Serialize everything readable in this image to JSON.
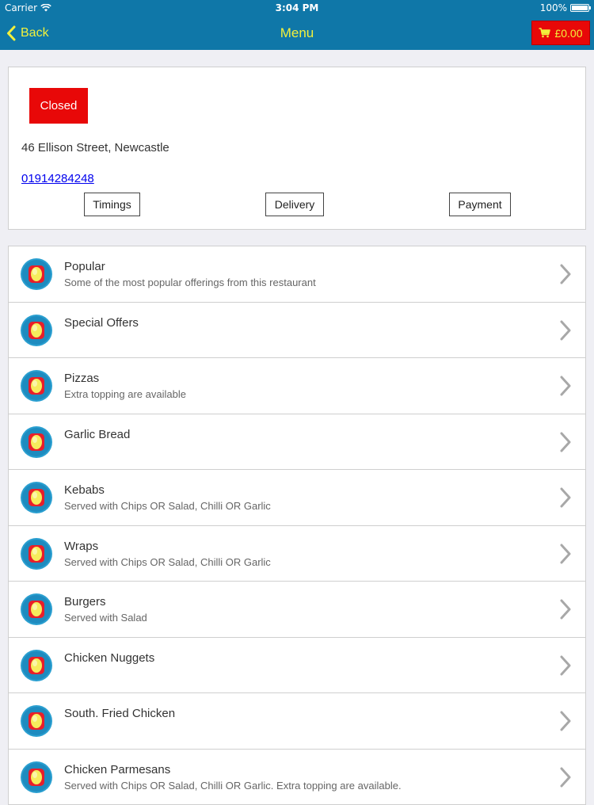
{
  "status_bar": {
    "carrier": "Carrier",
    "time": "3:04 PM",
    "battery": "100%"
  },
  "nav": {
    "back_label": "Back",
    "title": "Menu",
    "cart_total": "£0.00"
  },
  "info": {
    "status": "Closed",
    "address": "46 Ellison Street, Newcastle",
    "phone": "01914284248",
    "buttons": {
      "timings": "Timings",
      "delivery": "Delivery",
      "payment": "Payment"
    }
  },
  "menu": {
    "items": [
      {
        "title": "Popular",
        "subtitle": "Some of the most popular offerings from this restaurant"
      },
      {
        "title": "Special Offers",
        "subtitle": ""
      },
      {
        "title": "Pizzas",
        "subtitle": "Extra topping are available"
      },
      {
        "title": "Garlic Bread",
        "subtitle": ""
      },
      {
        "title": "Kebabs",
        "subtitle": "Served with Chips OR Salad, Chilli OR Garlic"
      },
      {
        "title": "Wraps",
        "subtitle": "Served with Chips OR Salad, Chilli OR Garlic"
      },
      {
        "title": "Burgers",
        "subtitle": "Served with Salad"
      },
      {
        "title": "Chicken Nuggets",
        "subtitle": ""
      },
      {
        "title": "South. Fried Chicken",
        "subtitle": ""
      },
      {
        "title": "Chicken Parmesans",
        "subtitle": "Served with Chips OR Salad, Chilli OR Garlic. Extra topping are available."
      }
    ]
  },
  "icons": {
    "wifi": "wifi-icon",
    "battery": "battery-icon",
    "back": "chevron-left-icon",
    "cart": "cart-icon",
    "category": "category-icon",
    "row_arrow": "chevron-right-icon"
  },
  "colors": {
    "nav_background": "#0f77a8",
    "nav_text": "#f2f03c",
    "cart_background": "#e80808",
    "closed_badge": "#e80808",
    "link": "#0000ee"
  }
}
